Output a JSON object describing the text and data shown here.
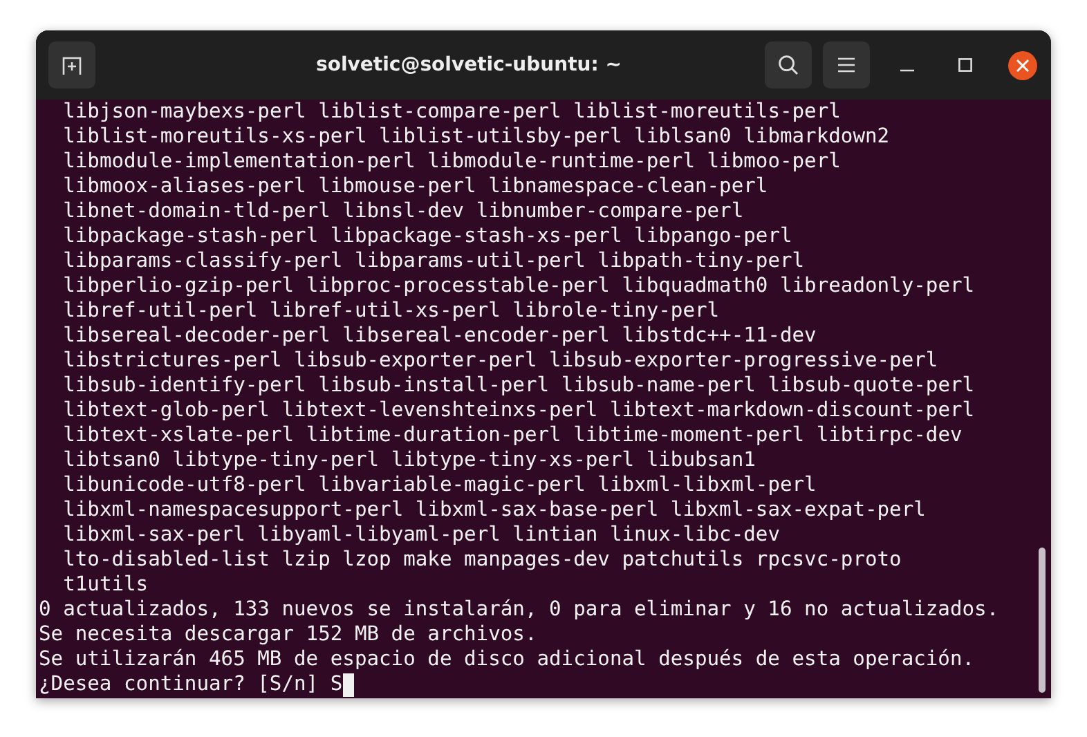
{
  "window": {
    "title": "solvetic@solvetic-ubuntu: ~"
  },
  "terminal": {
    "lines": [
      {
        "kind": "indented",
        "text": "libjson-maybexs-perl liblist-compare-perl liblist-moreutils-perl"
      },
      {
        "kind": "indented",
        "text": "liblist-moreutils-xs-perl liblist-utilsby-perl liblsan0 libmarkdown2"
      },
      {
        "kind": "indented",
        "text": "libmodule-implementation-perl libmodule-runtime-perl libmoo-perl"
      },
      {
        "kind": "indented",
        "text": "libmoox-aliases-perl libmouse-perl libnamespace-clean-perl"
      },
      {
        "kind": "indented",
        "text": "libnet-domain-tld-perl libnsl-dev libnumber-compare-perl"
      },
      {
        "kind": "indented",
        "text": "libpackage-stash-perl libpackage-stash-xs-perl libpango-perl"
      },
      {
        "kind": "indented",
        "text": "libparams-classify-perl libparams-util-perl libpath-tiny-perl"
      },
      {
        "kind": "indented",
        "text": "libperlio-gzip-perl libproc-processtable-perl libquadmath0 libreadonly-perl"
      },
      {
        "kind": "indented",
        "text": "libref-util-perl libref-util-xs-perl librole-tiny-perl"
      },
      {
        "kind": "indented",
        "text": "libsereal-decoder-perl libsereal-encoder-perl libstdc++-11-dev"
      },
      {
        "kind": "indented",
        "text": "libstrictures-perl libsub-exporter-perl libsub-exporter-progressive-perl"
      },
      {
        "kind": "indented",
        "text": "libsub-identify-perl libsub-install-perl libsub-name-perl libsub-quote-perl"
      },
      {
        "kind": "indented",
        "text": "libtext-glob-perl libtext-levenshteinxs-perl libtext-markdown-discount-perl"
      },
      {
        "kind": "indented",
        "text": "libtext-xslate-perl libtime-duration-perl libtime-moment-perl libtirpc-dev"
      },
      {
        "kind": "indented",
        "text": "libtsan0 libtype-tiny-perl libtype-tiny-xs-perl libubsan1"
      },
      {
        "kind": "indented",
        "text": "libunicode-utf8-perl libvariable-magic-perl libxml-libxml-perl"
      },
      {
        "kind": "indented",
        "text": "libxml-namespacesupport-perl libxml-sax-base-perl libxml-sax-expat-perl"
      },
      {
        "kind": "indented",
        "text": "libxml-sax-perl libyaml-libyaml-perl lintian linux-libc-dev"
      },
      {
        "kind": "indented",
        "text": "lto-disabled-list lzip lzop make manpages-dev patchutils rpcsvc-proto"
      },
      {
        "kind": "indented",
        "text": "t1utils"
      },
      {
        "kind": "plain",
        "text": "0 actualizados, 133 nuevos se instalarán, 0 para eliminar y 16 no actualizados."
      },
      {
        "kind": "plain",
        "text": "Se necesita descargar 152 MB de archivos."
      },
      {
        "kind": "plain",
        "text": "Se utilizarán 465 MB de espacio de disco adicional después de esta operación."
      },
      {
        "kind": "prompt",
        "text": "¿Desea continuar? [S/n] S"
      }
    ]
  }
}
